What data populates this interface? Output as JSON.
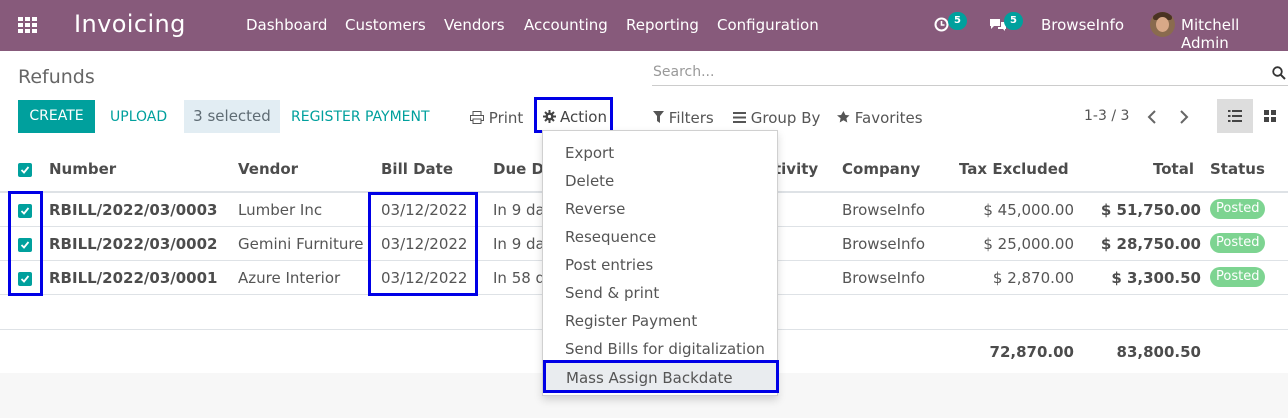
{
  "topbar": {
    "app_name": "Invoicing",
    "menu": [
      "Dashboard",
      "Customers",
      "Vendors",
      "Accounting",
      "Reporting",
      "Configuration"
    ],
    "activity_count": "5",
    "messages_count": "5",
    "company": "BrowseInfo",
    "user": "Mitchell Admin",
    "bg_color": "#875a7b"
  },
  "control_panel": {
    "title": "Refunds",
    "search_placeholder": "Search...",
    "create_label": "CREATE",
    "upload_label": "UPLOAD",
    "selected_label": "3 selected",
    "register_payment_label": "REGISTER PAYMENT",
    "print_label": "Print",
    "action_label": "Action",
    "filters_label": "Filters",
    "group_by_label": "Group By",
    "favorites_label": "Favorites",
    "pager": "1-3 / 3"
  },
  "table": {
    "columns": [
      "Number",
      "Vendor",
      "Bill Date",
      "Due Da",
      "tivity",
      "Company",
      "Tax Excluded",
      "Total",
      "Status"
    ],
    "rows": [
      {
        "number": "RBILL/2022/03/0003",
        "vendor": "Lumber Inc",
        "bill_date": "03/12/2022",
        "due": "In 9 da",
        "company": "BrowseInfo",
        "tax_excluded": "$ 45,000.00",
        "total": "$ 51,750.00",
        "status": "Posted"
      },
      {
        "number": "RBILL/2022/03/0002",
        "vendor": "Gemini Furniture",
        "bill_date": "03/12/2022",
        "due": "In 9 da",
        "company": "BrowseInfo",
        "tax_excluded": "$ 25,000.00",
        "total": "$ 28,750.00",
        "status": "Posted"
      },
      {
        "number": "RBILL/2022/03/0001",
        "vendor": "Azure Interior",
        "bill_date": "03/12/2022",
        "due": "In 58 d",
        "company": "BrowseInfo",
        "tax_excluded": "$ 2,870.00",
        "total": "$ 3,300.50",
        "status": "Posted"
      }
    ],
    "footer": {
      "tax_excluded": "72,870.00",
      "total": "83,800.50"
    }
  },
  "action_menu": {
    "items": [
      "Export",
      "Delete",
      "Reverse",
      "Resequence",
      "Post entries",
      "Send & print",
      "Register Payment",
      "Send Bills for digitalization",
      "Mass Assign Backdate"
    ]
  },
  "colors": {
    "accent": "#00a09d",
    "highlight": "#0000e6",
    "posted": "#7dd491"
  }
}
